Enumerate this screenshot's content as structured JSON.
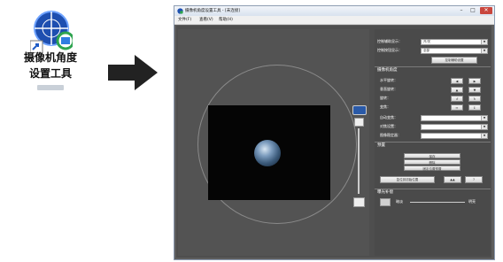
{
  "desktop_icon": {
    "line1": "摄像机角度",
    "line2": "设置工具"
  },
  "window": {
    "title": "摄像机角度设置工具 - [未连接]",
    "min": "–",
    "max": "□",
    "close": "✕"
  },
  "menu": {
    "file": "文件(F)",
    "view": "查看(V)",
    "help": "帮助(H)"
  },
  "panel": {
    "control_target_label": "控制辅助显示：",
    "control_target_value": "开/关",
    "control_display_label": "控制按钮显示：",
    "control_display_value": "全部",
    "control_apply_btn": "控制辅助设置",
    "camera_section": "摄像机角度",
    "horizontal_label": "水平旋转：",
    "vertical_label": "垂直旋转：",
    "rotate_label": "旋转：",
    "zoom_label": "变焦：",
    "auto_label": "自动变焦：",
    "focus_label": "对焦设置：",
    "image_label": "图像稳定器：",
    "preset_section": "预置",
    "preset_btn1": "保存",
    "preset_btn2": "删除",
    "preset_btn3": "固定位置预置",
    "preset_reset_btn": "复位到初始位置",
    "compensate_section": "曝光补偿",
    "slider_left": "暗淡",
    "slider_right": "明亮"
  },
  "icons": {
    "arrow": "right-arrow-icon",
    "app": "camera-angle-app-icon",
    "shortcut": "shortcut-arrow-icon"
  }
}
